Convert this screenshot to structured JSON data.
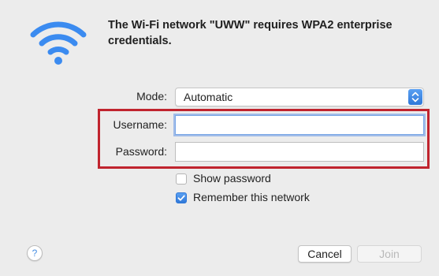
{
  "dialog": {
    "title": "The Wi-Fi network \"UWW\" requires WPA2 enterprise credentials."
  },
  "form": {
    "mode_label": "Mode:",
    "mode_value": "Automatic",
    "username_label": "Username:",
    "username_value": "",
    "password_label": "Password:",
    "password_value": ""
  },
  "options": {
    "show_password_label": "Show password",
    "show_password_checked": false,
    "remember_label": "Remember this network",
    "remember_checked": true
  },
  "buttons": {
    "help_label": "?",
    "cancel_label": "Cancel",
    "join_label": "Join"
  },
  "colors": {
    "accent": "#3b8bf0",
    "highlight_box": "#c0242e"
  },
  "icons": {
    "wifi": "wifi-icon",
    "stepper": "chevron-updown-icon",
    "check": "checkmark-icon"
  }
}
